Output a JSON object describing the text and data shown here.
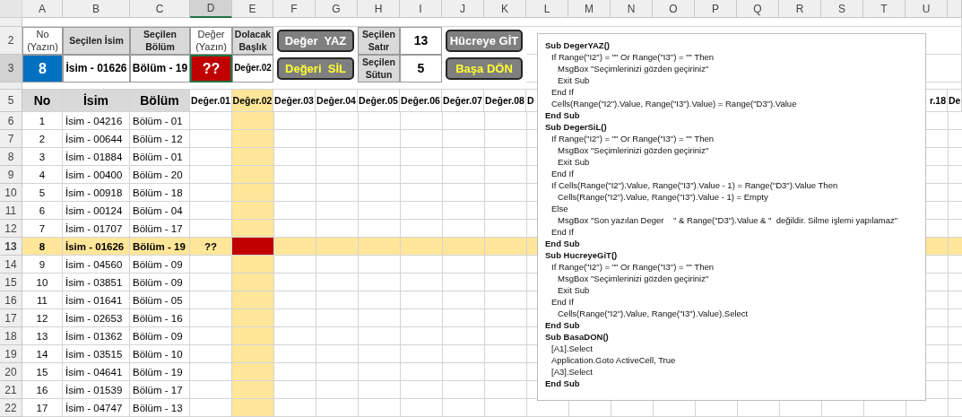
{
  "column_letters": [
    {
      "label": "A",
      "selected": false
    },
    {
      "label": "B",
      "selected": false
    },
    {
      "label": "C",
      "selected": false
    },
    {
      "label": "D",
      "selected": true
    },
    {
      "label": "E",
      "selected": false
    },
    {
      "label": "F",
      "selected": false
    },
    {
      "label": "G",
      "selected": false
    },
    {
      "label": "H",
      "selected": false
    },
    {
      "label": "I",
      "selected": false
    },
    {
      "label": "J",
      "selected": false
    },
    {
      "label": "K",
      "selected": false
    },
    {
      "label": "L",
      "selected": false
    },
    {
      "label": "M",
      "selected": false
    },
    {
      "label": "N",
      "selected": false
    },
    {
      "label": "O",
      "selected": false
    },
    {
      "label": "P",
      "selected": false
    },
    {
      "label": "Q",
      "selected": false
    },
    {
      "label": "R",
      "selected": false
    },
    {
      "label": "S",
      "selected": false
    },
    {
      "label": "T",
      "selected": false
    },
    {
      "label": "U",
      "selected": false
    }
  ],
  "panel_rows": [
    {
      "row": "2",
      "selected": false,
      "fields": [
        {
          "label": "No (Yazın)",
          "kind": "input"
        },
        {
          "label": "Seçilen İsim",
          "kind": "output"
        },
        {
          "label": "Seçilen Bölüm",
          "kind": "output"
        },
        {
          "label": "Değer (Yazın)",
          "kind": "input"
        },
        {
          "label": "Dolacak Başlık",
          "kind": "output"
        }
      ],
      "button_left": {
        "label": "Değer  YAZ",
        "highlighted": false
      },
      "selection": {
        "label": "Seçilen Satır",
        "value": "13"
      },
      "button_right": {
        "label": "Hücreye GİT",
        "highlighted": false
      }
    },
    {
      "row": "3",
      "selected": true,
      "fields": [
        {
          "value": "8",
          "kind": "input",
          "color": "#0070c0"
        },
        {
          "value": "İsim - 01626",
          "kind": "output"
        },
        {
          "value": "Bölüm - 19",
          "kind": "output"
        },
        {
          "value": "??",
          "kind": "input",
          "color": "#c00000"
        },
        {
          "value": "Değer.02",
          "kind": "output"
        }
      ],
      "button_left": {
        "label": "Değeri  SİL",
        "highlighted": true
      },
      "selection": {
        "label": "Seçilen Sütun",
        "value": "5"
      },
      "button_right": {
        "label": "Başa DÖN",
        "highlighted": true
      }
    }
  ],
  "header_row": {
    "row": "5",
    "fixed": [
      "No",
      "İsim",
      "Bölüm"
    ],
    "values": [
      {
        "label": "Değer.01",
        "highlighted": false
      },
      {
        "label": "Değer.02",
        "highlighted": true
      },
      {
        "label": "Değer.03",
        "highlighted": false
      },
      {
        "label": "Değer.04",
        "highlighted": false
      },
      {
        "label": "Değer.05",
        "highlighted": false
      },
      {
        "label": "Değer.06",
        "highlighted": false
      },
      {
        "label": "Değer.07",
        "highlighted": false
      },
      {
        "label": "Değer.08",
        "highlighted": false
      },
      {
        "label": "D",
        "highlighted": false
      }
    ],
    "edge": [
      "r.18",
      "De"
    ]
  },
  "rows": [
    {
      "row": "6",
      "no": "1",
      "name": "İsim - 04216",
      "section": "Bölüm - 01",
      "selected": false
    },
    {
      "row": "7",
      "no": "2",
      "name": "İsim - 00644",
      "section": "Bölüm - 12",
      "selected": false
    },
    {
      "row": "8",
      "no": "3",
      "name": "İsim - 01884",
      "section": "Bölüm - 01",
      "selected": false
    },
    {
      "row": "9",
      "no": "4",
      "name": "İsim - 00400",
      "section": "Bölüm - 20",
      "selected": false
    },
    {
      "row": "10",
      "no": "5",
      "name": "İsim - 00918",
      "section": "Bölüm - 18",
      "selected": false
    },
    {
      "row": "11",
      "no": "6",
      "name": "İsim - 00124",
      "section": "Bölüm - 04",
      "selected": false
    },
    {
      "row": "12",
      "no": "7",
      "name": "İsim - 01707",
      "section": "Bölüm - 17",
      "selected": false
    },
    {
      "row": "13",
      "no": "8",
      "name": "İsim - 01626",
      "section": "Bölüm - 19",
      "selected": true,
      "entry": "??"
    },
    {
      "row": "14",
      "no": "9",
      "name": "İsim - 04560",
      "section": "Bölüm - 09",
      "selected": false
    },
    {
      "row": "15",
      "no": "10",
      "name": "İsim - 03851",
      "section": "Bölüm - 09",
      "selected": false
    },
    {
      "row": "16",
      "no": "11",
      "name": "İsim - 01641",
      "section": "Bölüm - 05",
      "selected": false
    },
    {
      "row": "17",
      "no": "12",
      "name": "İsim - 02653",
      "section": "Bölüm - 16",
      "selected": false
    },
    {
      "row": "18",
      "no": "13",
      "name": "İsim - 01362",
      "section": "Bölüm - 09",
      "selected": false
    },
    {
      "row": "19",
      "no": "14",
      "name": "İsim - 03515",
      "section": "Bölüm - 10",
      "selected": false
    },
    {
      "row": "20",
      "no": "15",
      "name": "İsim - 04641",
      "section": "Bölüm - 19",
      "selected": false
    },
    {
      "row": "21",
      "no": "16",
      "name": "İsim - 01539",
      "section": "Bölüm - 17",
      "selected": false
    },
    {
      "row": "22",
      "no": "17",
      "name": "İsim - 04747",
      "section": "Bölüm - 13",
      "selected": false
    }
  ],
  "code": [
    {
      "text": "Sub DegerYAZ()",
      "bold": true,
      "children": [
        {
          "text": "If Range(\"I2\") = \"\" Or Range(\"I3\") = \"\" Then",
          "bold": false,
          "children": [
            {
              "text": "MsgBox \"Seçimlerinizi gözden geçiriniz\"",
              "bold": false
            },
            {
              "text": "Exit Sub",
              "bold": false
            }
          ]
        },
        {
          "text": "End If",
          "bold": false
        },
        {
          "text": "Cells(Range(\"I2\").Value, Range(\"I3\").Value) = Range(\"D3\").Value",
          "bold": false
        }
      ]
    },
    {
      "text": "End Sub",
      "bold": true
    },
    {
      "text": "Sub DegerSiL()",
      "bold": true,
      "children": [
        {
          "text": "If Range(\"I2\") = \"\" Or Range(\"I3\") = \"\" Then",
          "bold": false,
          "children": [
            {
              "text": "MsgBox \"Seçimlerinizi gözden geçiriniz\"",
              "bold": false
            },
            {
              "text": "Exit Sub",
              "bold": false
            }
          ]
        },
        {
          "text": "End If",
          "bold": false
        },
        {
          "text": "If Cells(Range(\"I2\").Value, Range(\"I3\").Value - 1) = Range(\"D3\").Value Then",
          "bold": false,
          "children": [
            {
              "text": "Cells(Range(\"I2\").Value, Range(\"I3\").Value - 1) = Empty",
              "bold": false
            }
          ]
        },
        {
          "text": "Else",
          "bold": false,
          "children": [
            {
              "text": "MsgBox \"Son yazılan Deger    \" & Range(\"D3\").Value & \"  değildir. Silme işlemi yapılamaz\"",
              "bold": false
            }
          ]
        },
        {
          "text": "End If",
          "bold": false
        }
      ]
    },
    {
      "text": "End Sub",
      "bold": true
    },
    {
      "text": "Sub HucreyeGiT()",
      "bold": true,
      "children": [
        {
          "text": "If Range(\"I2\") = \"\" Or Range(\"I3\") = \"\" Then",
          "bold": false,
          "children": [
            {
              "text": "MsgBox \"Seçimlerinizi gözden geçiriniz\"",
              "bold": false
            },
            {
              "text": "Exit Sub",
              "bold": false
            }
          ]
        },
        {
          "text": "End If",
          "bold": false,
          "children": [
            {
              "text": "Cells(Range(\"I2\").Value, Range(\"I3\").Value).Select",
              "bold": false
            }
          ]
        }
      ]
    },
    {
      "text": "End Sub",
      "bold": true
    },
    {
      "text": "Sub BasaDON()",
      "bold": true,
      "children": [
        {
          "text": "[A1].Select",
          "bold": false
        },
        {
          "text": "Application.Goto ActiveCell, True",
          "bold": false
        },
        {
          "text": "[A3].Select",
          "bold": false
        }
      ]
    },
    {
      "text": "End Sub",
      "bold": true
    }
  ]
}
